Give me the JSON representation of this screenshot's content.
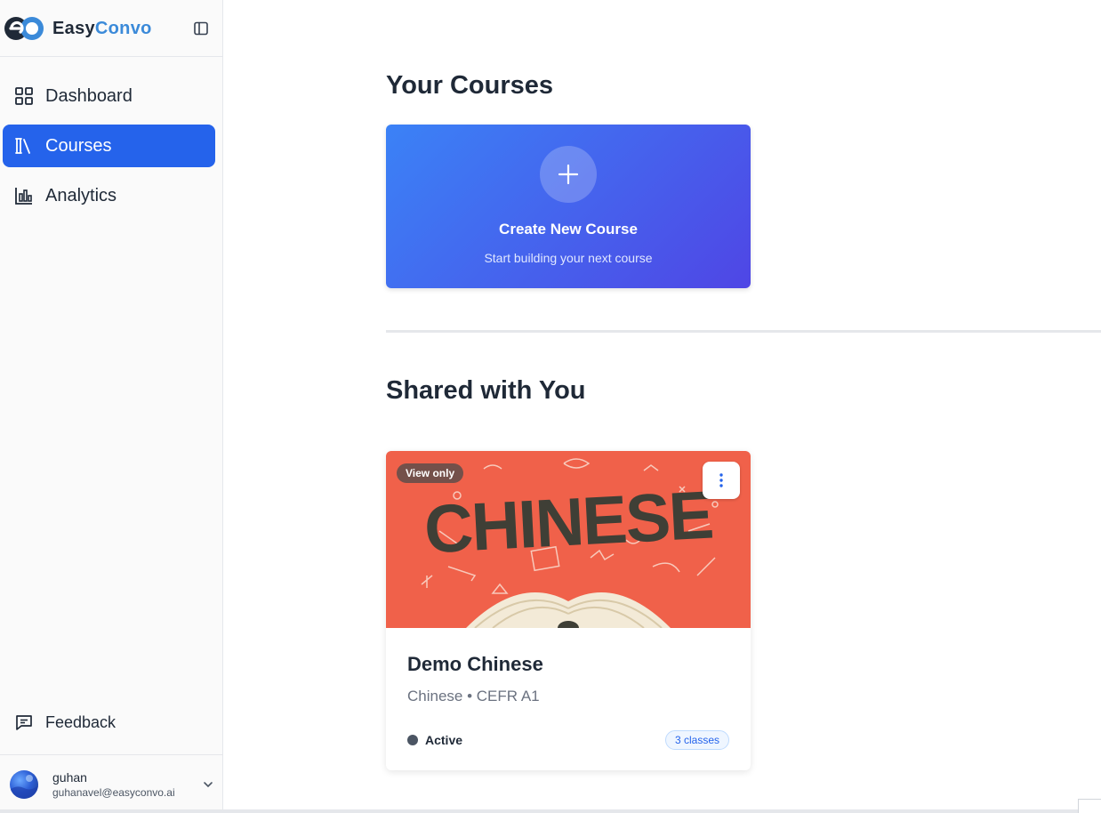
{
  "brand": {
    "part1": "Easy",
    "part2": "Convo"
  },
  "sidebar": {
    "items": [
      {
        "label": "Dashboard",
        "icon": "dashboard-grid-icon",
        "active": false
      },
      {
        "label": "Courses",
        "icon": "books-icon",
        "active": true
      },
      {
        "label": "Analytics",
        "icon": "bar-chart-icon",
        "active": false
      }
    ],
    "feedback_label": "Feedback",
    "user": {
      "name": "guhan",
      "email": "guhanavel@easyconvo.ai"
    }
  },
  "main": {
    "your_courses_title": "Your Courses",
    "create_card": {
      "title": "Create New Course",
      "subtitle": "Start building your next course"
    },
    "shared_title": "Shared with You",
    "shared_courses": [
      {
        "badge": "View only",
        "cover_text": "CHINESE",
        "title": "Demo Chinese",
        "meta": "Chinese • CEFR A1",
        "status": "Active",
        "classes": "3 classes"
      }
    ]
  },
  "colors": {
    "accent": "#2563eb",
    "brand_blue": "#3b8ad9",
    "cover_bg": "#f0614a",
    "create_gradient_start": "#3b82f6",
    "create_gradient_end": "#4f46e5"
  }
}
